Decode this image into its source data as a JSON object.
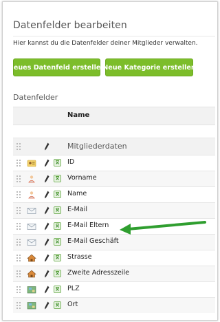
{
  "page": {
    "title": "Datenfelder bearbeiten",
    "description": "Hier kannst du die Datenfelder deiner Mitglieder verwalten."
  },
  "buttons": {
    "new_field": "Neues Datenfeld erstellen",
    "new_category": "Neue Kategorie erstellen"
  },
  "section": {
    "title": "Datenfelder"
  },
  "table": {
    "column_name": "Name",
    "group_label": "Mitgliederdaten",
    "rows": [
      {
        "label": "ID",
        "icon": "id-card-icon"
      },
      {
        "label": "Vorname",
        "icon": "person-icon"
      },
      {
        "label": "Name",
        "icon": "person-icon"
      },
      {
        "label": "E-Mail",
        "icon": "envelope-icon"
      },
      {
        "label": "E-Mail Eltern",
        "icon": "envelope-icon"
      },
      {
        "label": "E-Mail Geschäft",
        "icon": "envelope-icon"
      },
      {
        "label": "Strasse",
        "icon": "house-icon"
      },
      {
        "label": "Zweite Adresszeile",
        "icon": "house-icon"
      },
      {
        "label": "PLZ",
        "icon": "map-icon"
      },
      {
        "label": "Ort",
        "icon": "map-icon"
      }
    ]
  },
  "colors": {
    "button_green": "#7cbd2a",
    "arrow_green": "#2f9e2f",
    "header_gray": "#f2f2f2"
  }
}
